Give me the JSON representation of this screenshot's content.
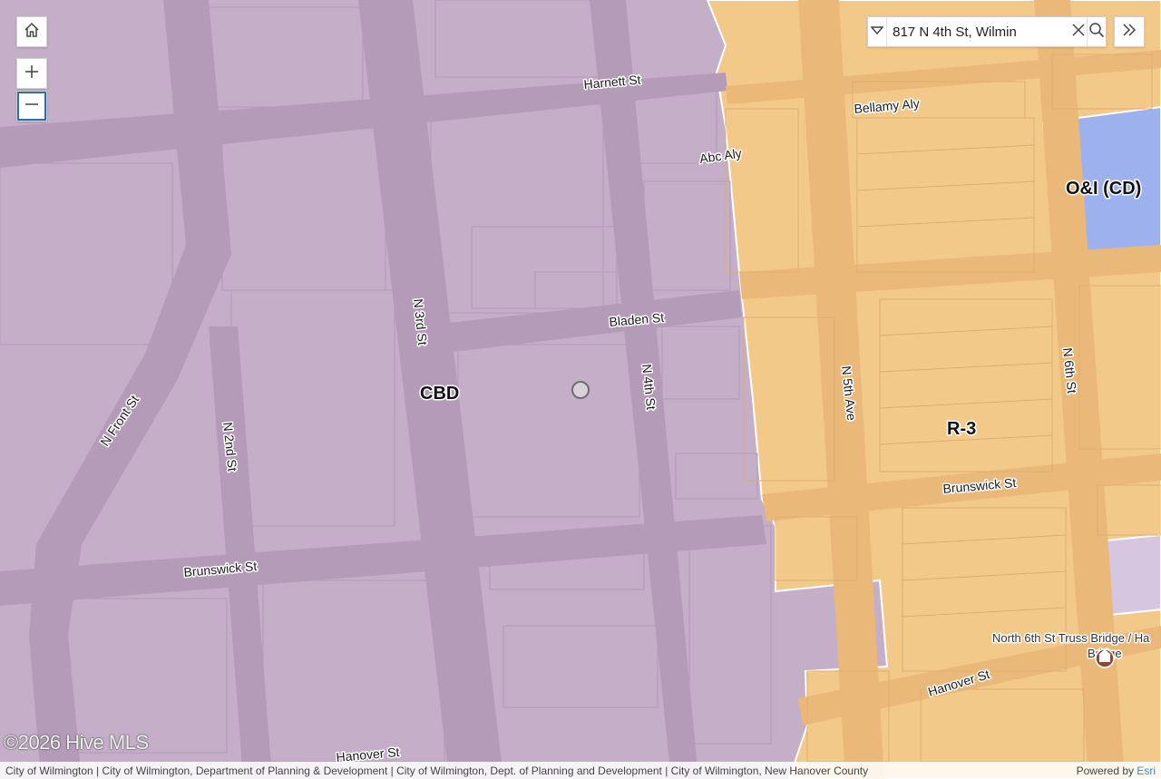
{
  "controls": {
    "home_icon": "home-icon",
    "zoom_in_icon": "plus-icon",
    "zoom_out_icon": "minus-icon"
  },
  "search": {
    "value": "817 N 4th St, Wilmin",
    "dropdown_icon": "caret-down-icon",
    "clear_icon": "close-icon",
    "search_icon": "search-icon"
  },
  "expand_icon": "double-chevron-right-icon",
  "zones": {
    "cbd": "CBD",
    "r3": "R-3",
    "oi": "O&I (CD)"
  },
  "colors": {
    "cbd": "#c4aec8",
    "r3": "#f3c98a",
    "oi": "#9db1ef",
    "road_cbd": "#b49bb8",
    "road_r3": "#eab97a"
  },
  "streets": {
    "harnett": "Harnett St",
    "bellamy": "Bellamy Aly",
    "abc": "Abc Aly",
    "bladen": "Bladen St",
    "n3rd": "N 3rd St",
    "n4th": "N 4th St",
    "n5th": "N 5th Ave",
    "n6th": "N 6th St",
    "nfront": "N Front St",
    "n2nd": "N 2nd St",
    "brunswick_left": "Brunswick St",
    "brunswick_right": "Brunswick St",
    "hanover_left": "Hanover St",
    "hanover_right": "Hanover St"
  },
  "poi": {
    "line1": "North 6th St Truss Bridge / Ha",
    "line2": "Bridge",
    "icon": "landmark-icon"
  },
  "watermark": "©2026 Hive MLS",
  "attribution": {
    "sources": "City of Wilmington | City of Wilmington, Department of Planning & Development | City of Wilmington, Dept. of Planning and Development | City of Wilmington, New Hanover County",
    "powered_by": "Powered by ",
    "esri": "Esri"
  }
}
